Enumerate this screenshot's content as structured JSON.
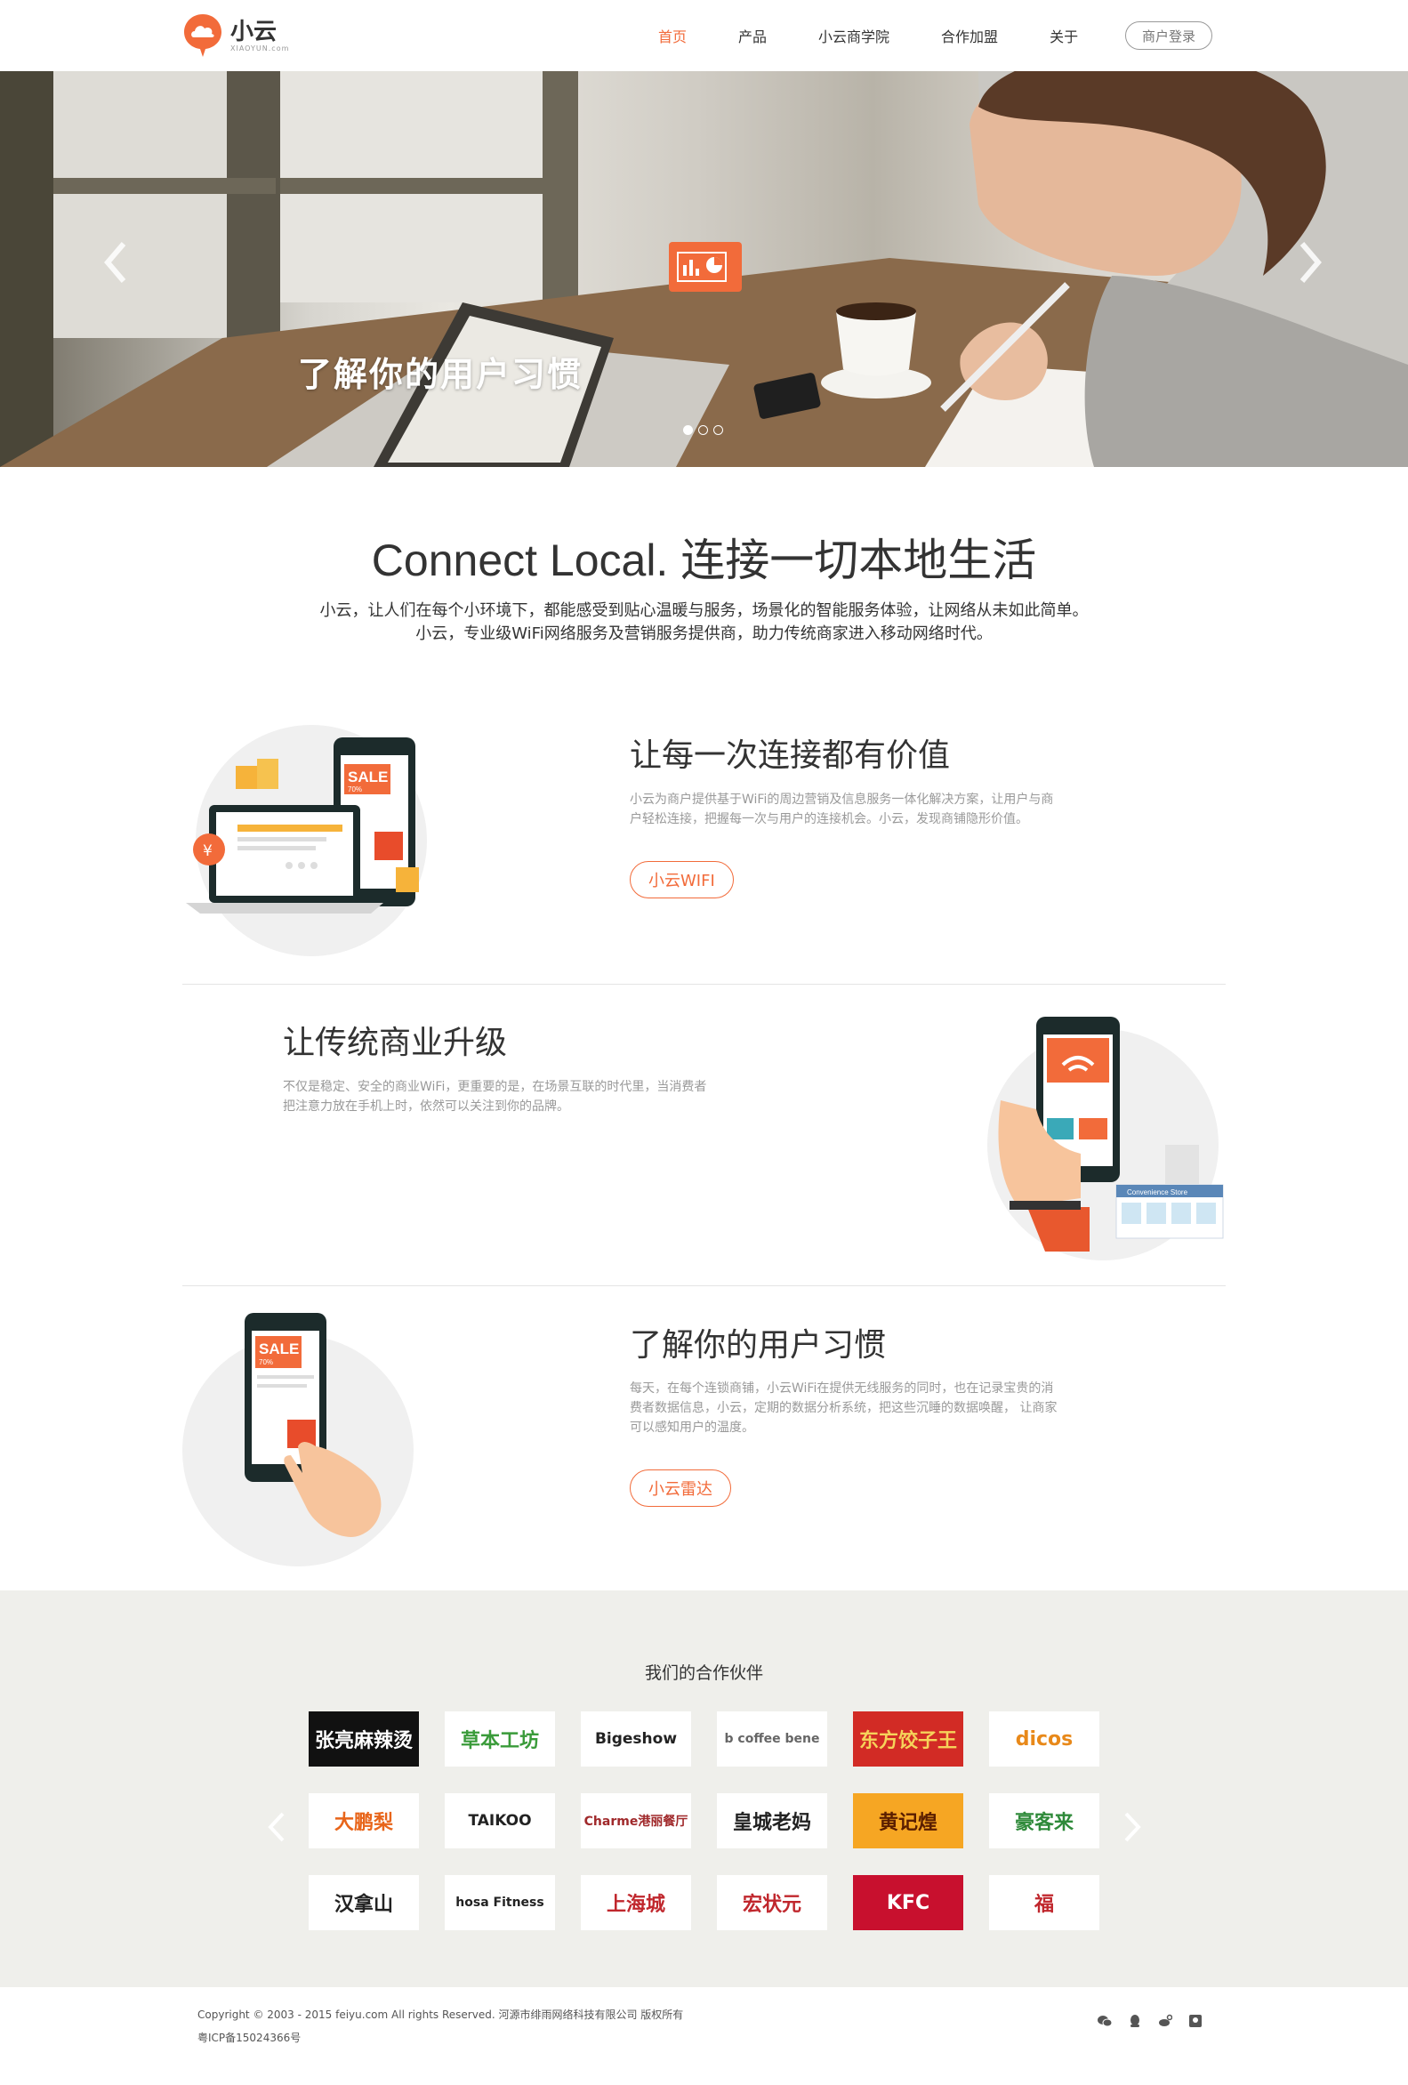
{
  "header": {
    "logo_cn": "小云",
    "logo_en": "XIAOYUN.com",
    "nav": [
      "首页",
      "产品",
      "小云商学院",
      "合作加盟",
      "关于"
    ],
    "login": "商户登录"
  },
  "banner": {
    "title": "了解你的用户习惯",
    "slides_total": 3,
    "slide_active": 1
  },
  "intro": {
    "title": "Connect Local. 连接一切本地生活",
    "line1": "小云，让人们在每个小环境下，都能感受到贴心温暖与服务，场景化的智能服务体验，让网络从未如此简单。",
    "line2": "小云，专业级WiFi网络服务及营销服务提供商，助力传统商家进入移动网络时代。"
  },
  "features": [
    {
      "title": "让每一次连接都有价值",
      "desc1": "小云为商户提供基于WiFi的周边营销及信息服务一体化解决方案，让用户与商",
      "desc2": "户轻松连接，把握每一次与用户的连接机会。小云，发现商铺隐形价值。",
      "button": "小云WIFI",
      "ill_sale": "SALE",
      "ill_pct": "70%"
    },
    {
      "title": "让传统商业升级",
      "desc1": "不仅是稳定、安全的商业WiFi，更重要的是，在场景互联的时代里，当消费者",
      "desc2": "把注意力放在手机上时，依然可以关注到你的品牌。",
      "ill_store": "Convenience Store"
    },
    {
      "title": "了解你的用户习惯",
      "desc1": "每天，在每个连锁商铺，小云WiFi在提供无线服务的同时，也在记录宝贵的消",
      "desc2": "费者数据信息，小云，定期的数据分析系统，把这些沉睡的数据唤醒， 让商家",
      "desc3": "可以感知用户的温度。",
      "button": "小云雷达",
      "ill_sale": "SALE",
      "ill_pct": "70%"
    }
  ],
  "partners": {
    "title": "我们的合作伙伴",
    "brands": [
      {
        "name": "张亮麻辣烫",
        "bg": "#111111",
        "color": "#ffffff"
      },
      {
        "name": "草本工坊",
        "bg": "#ffffff",
        "color": "#3a9b3a"
      },
      {
        "name": "Bigeshow",
        "bg": "#ffffff",
        "color": "#222222"
      },
      {
        "name": "b coffee bene",
        "bg": "#ffffff",
        "color": "#666666"
      },
      {
        "name": "东方饺子王",
        "bg": "#d22b25",
        "color": "#f6d35a"
      },
      {
        "name": "dicos",
        "bg": "#ffffff",
        "color": "#e8891a"
      },
      {
        "name": "大鹏梨",
        "bg": "#ffffff",
        "color": "#e8651a"
      },
      {
        "name": "TAIKOO",
        "bg": "#ffffff",
        "color": "#222222"
      },
      {
        "name": "Charme港丽餐厅",
        "bg": "#ffffff",
        "color": "#a0292b"
      },
      {
        "name": "皇城老妈",
        "bg": "#ffffff",
        "color": "#222222"
      },
      {
        "name": "黄记煌",
        "bg": "#f6a623",
        "color": "#5a1e00"
      },
      {
        "name": "豪客来",
        "bg": "#ffffff",
        "color": "#2f8a3a"
      },
      {
        "name": "汉拿山",
        "bg": "#ffffff",
        "color": "#222222"
      },
      {
        "name": "hosa Fitness",
        "bg": "#ffffff",
        "color": "#222222"
      },
      {
        "name": "上海城",
        "bg": "#ffffff",
        "color": "#c0272d"
      },
      {
        "name": "宏状元",
        "bg": "#ffffff",
        "color": "#c0272d"
      },
      {
        "name": "KFC",
        "bg": "#c8102e",
        "color": "#ffffff"
      },
      {
        "name": "福",
        "bg": "#ffffff",
        "color": "#c0272d"
      }
    ]
  },
  "footer": {
    "copyright": "Copyright © 2003 - 2015 feiyu.com All rights Reserved. 河源市绯雨网络科技有限公司 版权所有",
    "icp": "粤ICP备15024366号",
    "social": [
      "wechat-icon",
      "qq-icon",
      "weibo-icon",
      "tencent-weibo-icon"
    ]
  },
  "colors": {
    "accent": "#f26b3a",
    "partners_bg": "#efefeb"
  }
}
